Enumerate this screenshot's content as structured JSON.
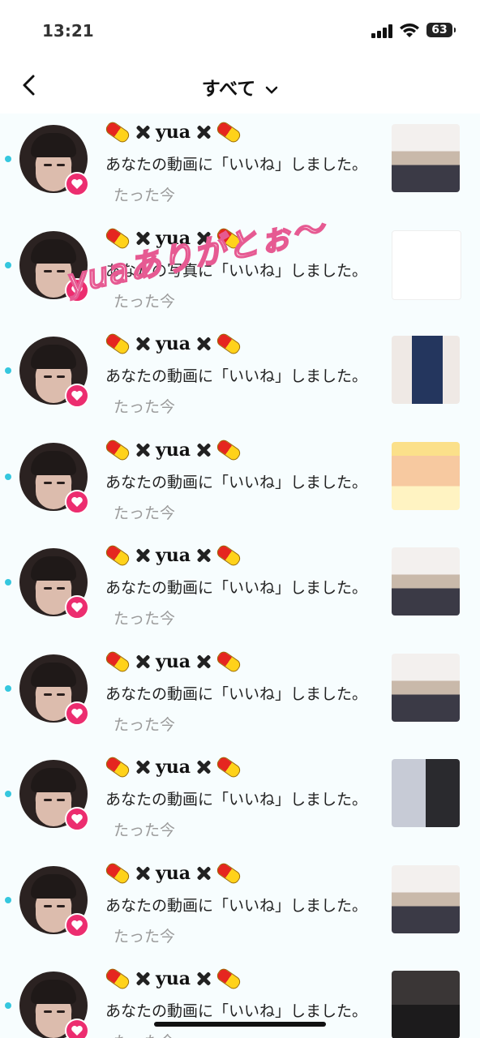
{
  "status": {
    "time": "13:21",
    "battery": "63"
  },
  "header": {
    "title": "すべて"
  },
  "sticker": {
    "text": "yuaありがとぉ〜"
  },
  "notifications": [
    {
      "name": "yua",
      "message": "あなたの動画に「いいね」しました。",
      "time": "たった今",
      "thumb": "video-selfie"
    },
    {
      "name": "yua",
      "message": "あなたの写真に「いいね」しました。",
      "time": "たった今",
      "thumb": "comment-screenshot"
    },
    {
      "name": "yua",
      "message": "あなたの動画に「いいね」しました。",
      "time": "たった今",
      "thumb": "video-pajama"
    },
    {
      "name": "yua",
      "message": "あなたの動画に「いいね」しました。",
      "time": "たった今",
      "thumb": "video-slide"
    },
    {
      "name": "yua",
      "message": "あなたの動画に「いいね」しました。",
      "time": "たった今",
      "thumb": "video-selfie"
    },
    {
      "name": "yua",
      "message": "あなたの動画に「いいね」しました。",
      "time": "たった今",
      "thumb": "video-selfie"
    },
    {
      "name": "yua",
      "message": "あなたの動画に「いいね」しました。",
      "time": "たった今",
      "thumb": "video-split"
    },
    {
      "name": "yua",
      "message": "あなたの動画に「いいね」しました。",
      "time": "たった今",
      "thumb": "video-selfie"
    },
    {
      "name": "yua",
      "message": "あなたの動画に「いいね」しました。",
      "time": "たった今",
      "thumb": "video-dark"
    }
  ],
  "colors": {
    "unread_dot": "#35c7de",
    "heart_badge": "#ec2d6f",
    "timestamp": "#9a9a9a"
  },
  "icons": {
    "back": "chevron-left-icon",
    "dropdown": "chevron-down-icon",
    "badge": "heart-icon"
  }
}
